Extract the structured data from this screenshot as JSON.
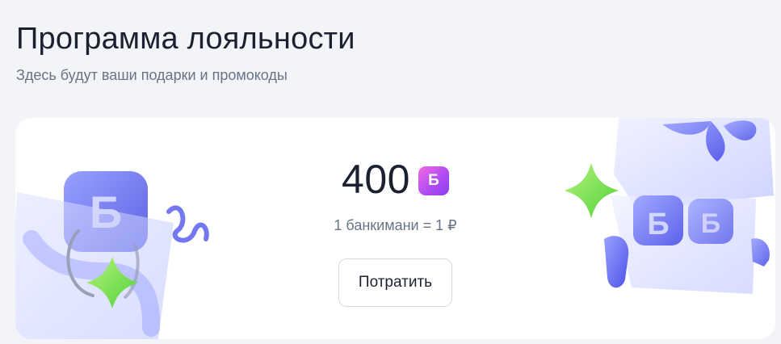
{
  "header": {
    "title": "Программа лояльности",
    "subtitle": "Здесь будут ваши подарки и промокоды"
  },
  "loyalty_card": {
    "balance": "400",
    "currency_badge": "Б",
    "exchange_rate": "1 банкимани = 1 ₽",
    "spend_button_label": "Потратить",
    "decor_left": "shopping-bag-illustration",
    "decor_right": "gift-box-illustration",
    "badge_colors": [
      "#f06be0",
      "#8a3df0"
    ],
    "accent_star_color": "#7ee04a"
  }
}
